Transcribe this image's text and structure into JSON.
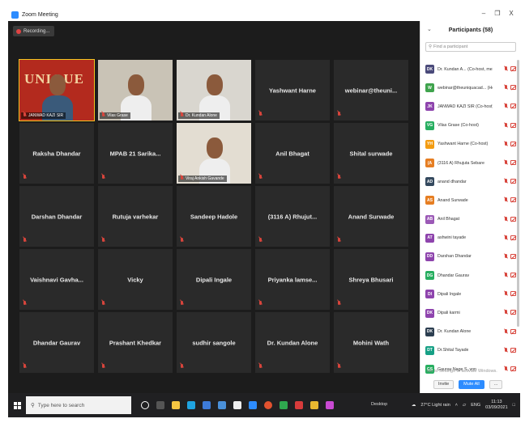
{
  "window": {
    "title": "Zoom Meeting",
    "minimize": "–",
    "restore": "❐",
    "close": "X"
  },
  "recording": {
    "label": "Recording..."
  },
  "tiles": [
    {
      "name": "JANWAD KAZI SIR",
      "type": "video",
      "active": true,
      "bg": "#b32a1e",
      "logo": "UNIQUE"
    },
    {
      "name": "Vilas Grase",
      "type": "video",
      "bg": "#c9c3b6"
    },
    {
      "name": "Dr. Kundan Alone",
      "type": "video",
      "bg": "#d9d6cf"
    },
    {
      "name": "Yashwant Harne",
      "type": "name"
    },
    {
      "name": "webinar@theuni...",
      "type": "name"
    },
    {
      "name": "Raksha Dhandar",
      "type": "name"
    },
    {
      "name": "MPAB 21 Sarika...",
      "type": "name"
    },
    {
      "name": "Viraj Ankish Gavande",
      "type": "video",
      "bg": "#e3ddd2"
    },
    {
      "name": "Anil Bhagat",
      "type": "name"
    },
    {
      "name": "Shital surwade",
      "type": "name"
    },
    {
      "name": "Darshan Dhandar",
      "type": "name"
    },
    {
      "name": "Rutuja varhekar",
      "type": "name"
    },
    {
      "name": "Sandeep Hadole",
      "type": "name"
    },
    {
      "name": "(3116 A) Rhujut...",
      "type": "name"
    },
    {
      "name": "Anand Surwade",
      "type": "name"
    },
    {
      "name": "Vaishnavi Gavha...",
      "type": "name"
    },
    {
      "name": "Vicky",
      "type": "name"
    },
    {
      "name": "Dipali Ingale",
      "type": "name"
    },
    {
      "name": "Priyanka lamse...",
      "type": "name"
    },
    {
      "name": "Shreya Bhusari",
      "type": "name"
    },
    {
      "name": "Dhandar Gaurav",
      "type": "name"
    },
    {
      "name": "Prashant Khedkar",
      "type": "name"
    },
    {
      "name": "sudhir sangole",
      "type": "name"
    },
    {
      "name": "Dr. Kundan Alone",
      "type": "name"
    },
    {
      "name": "Mohini Wath",
      "type": "name"
    }
  ],
  "participants_panel": {
    "title": "Participants (58)",
    "search_placeholder": "Find a participant",
    "items": [
      {
        "initials": "DK",
        "name": "Dr. Kundan A... (Co-host, me)",
        "color": "#4a4a7a"
      },
      {
        "initials": "W",
        "name": "webinar@theuniquacad... (Host)",
        "color": "#3fa34d"
      },
      {
        "initials": "JK",
        "name": "JANWAD KAZI SIR (Co-host)",
        "color": "#8e44ad"
      },
      {
        "initials": "VG",
        "name": "Vilas Grase (Co-host)",
        "color": "#27ae60"
      },
      {
        "initials": "YH",
        "name": "Yashwant Harne (Co-host)",
        "color": "#f39c12"
      },
      {
        "initials": "(A",
        "name": "(3116 A) Rhujuta Sebare",
        "color": "#e67e22"
      },
      {
        "initials": "AD",
        "name": "anand dhandar",
        "color": "#34495e"
      },
      {
        "initials": "AS",
        "name": "Anand Surwade",
        "color": "#e67e22"
      },
      {
        "initials": "AB",
        "name": "Anil Bhagat",
        "color": "#9b59b6"
      },
      {
        "initials": "AT",
        "name": "ashwini tayade",
        "color": "#8e44ad"
      },
      {
        "initials": "DD",
        "name": "Darshan Dhandar",
        "color": "#8e44ad"
      },
      {
        "initials": "DG",
        "name": "Dhandar Gaurav",
        "color": "#27ae60"
      },
      {
        "initials": "DI",
        "name": "Dipali Ingale",
        "color": "#8e44ad"
      },
      {
        "initials": "DK",
        "name": "Dipali karmi",
        "color": "#8e44ad"
      },
      {
        "initials": "DK",
        "name": "Dr. Kundan Alone",
        "color": "#2c3e50"
      },
      {
        "initials": "DT",
        "name": "Dr.Shital Tayade",
        "color": "#16a085"
      },
      {
        "initials": "GS",
        "name": "Gaurav Nage S..von",
        "color": "#27ae60"
      }
    ],
    "activate_text": "Go to Settings to activate Windows.",
    "invite_label": "Invite",
    "mute_all_label": "Mute All",
    "more_label": "..."
  },
  "taskbar": {
    "search_placeholder": "Type here to search",
    "desktop_label": "Desktop",
    "weather": "27°C Light rain",
    "language": "ENG",
    "time": "11:13",
    "date": "03/09/2021"
  }
}
